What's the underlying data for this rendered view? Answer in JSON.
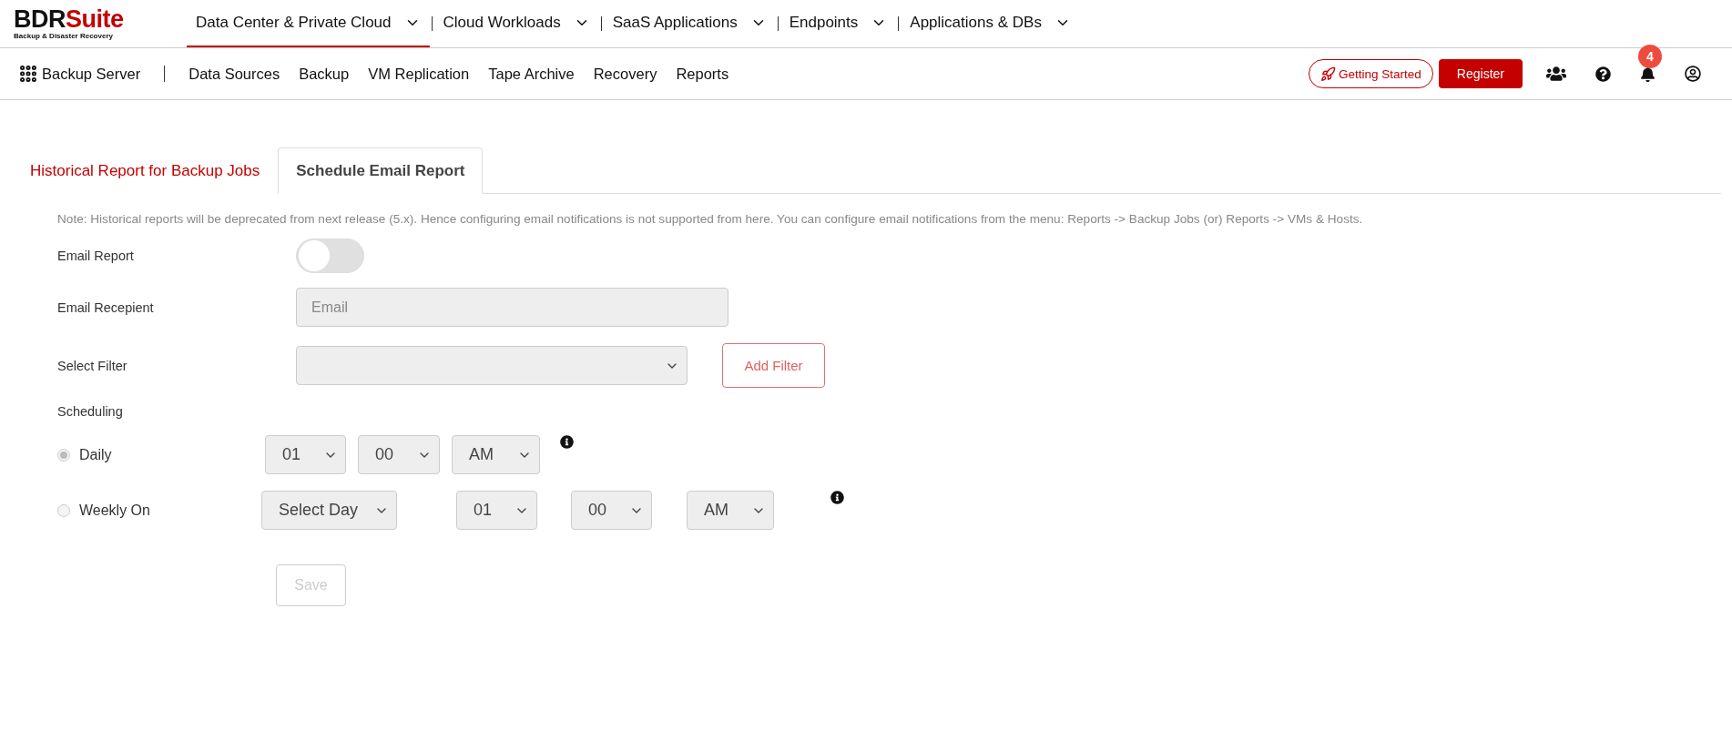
{
  "logo": {
    "brand": "BDR",
    "brand_accent": "Suite",
    "tagline": "Backup & Disaster Recovery"
  },
  "top_nav": [
    {
      "label": "Data Center & Private Cloud",
      "selected": true
    },
    {
      "label": "Cloud Workloads",
      "selected": false
    },
    {
      "label": "SaaS Applications",
      "selected": false
    },
    {
      "label": "Endpoints",
      "selected": false
    },
    {
      "label": "Applications & DBs",
      "selected": false
    }
  ],
  "product_bar": {
    "title": "Backup Server",
    "items": [
      "Data Sources",
      "Backup",
      "VM Replication",
      "Tape Archive",
      "Recovery",
      "Reports"
    ]
  },
  "actions": {
    "getting_started": "Getting Started",
    "register": "Register",
    "notification_count": "4"
  },
  "tabs": [
    {
      "label": "Historical Report for Backup Jobs",
      "selected": false
    },
    {
      "label": "Schedule Email Report",
      "selected": true
    }
  ],
  "note": "Note: Historical reports will be deprecated from next release (5.x). Hence configuring email notifications is not supported from here. You can configure email notifications from the menu: Reports -> Backup Jobs (or) Reports -> VMs & Hosts.",
  "form": {
    "email_report": {
      "label": "Email Report",
      "on": false
    },
    "email_recipient": {
      "label": "Email Recepient",
      "placeholder": "Email"
    },
    "select_filter": {
      "label": "Select Filter",
      "button": "Add Filter"
    }
  },
  "scheduling": {
    "title": "Scheduling",
    "options": [
      {
        "kind": "daily",
        "label": "Daily",
        "selected": true,
        "hour": "01",
        "minute": "00",
        "period": "AM"
      },
      {
        "kind": "weekly",
        "label": "Weekly On",
        "selected": false,
        "day": "Select Day",
        "hour": "01",
        "minute": "00",
        "period": "AM"
      }
    ]
  },
  "save": {
    "label": "Save",
    "disabled": true
  }
}
